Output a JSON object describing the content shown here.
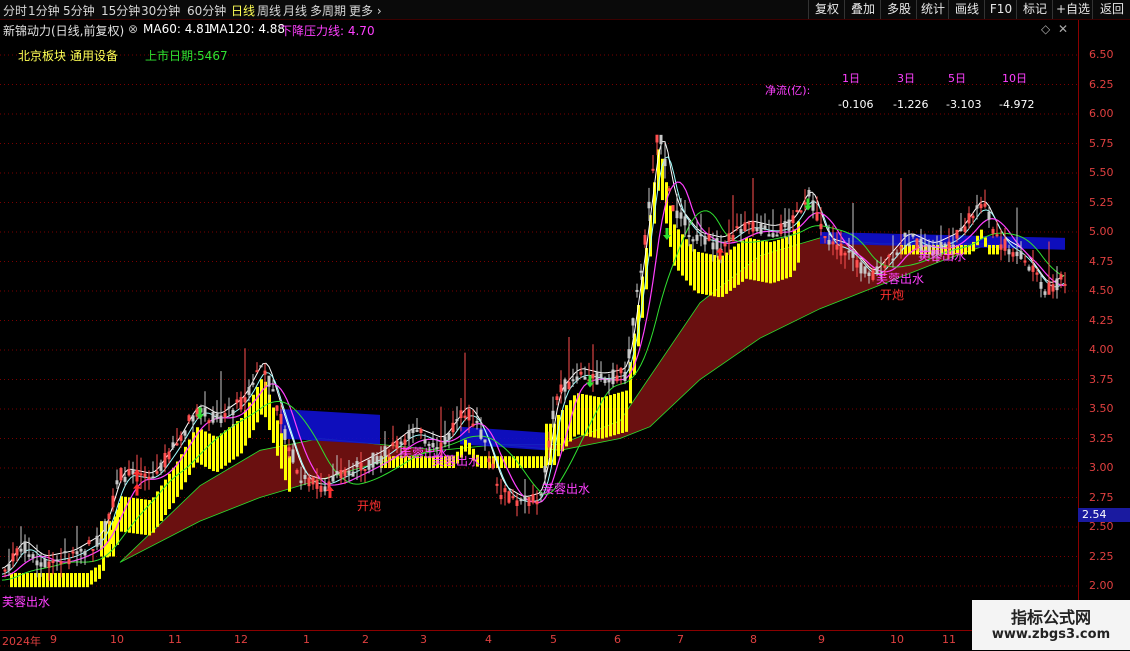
{
  "period_tabs": [
    "分时",
    "1分钟",
    "5分钟",
    "15分钟",
    "30分钟",
    "60分钟",
    "日线",
    "周线",
    "月线",
    "多周期",
    "更多"
  ],
  "active_period": "日线",
  "right_buttons": [
    "复权",
    "叠加",
    "多股",
    "统计",
    "画线",
    "F10",
    "标记",
    "+自选",
    "返回"
  ],
  "stock": {
    "title": "新锦动力(日线,前复权)",
    "ma60": "MA60: 4.81",
    "ma120": "MA120: 4.88",
    "resistance": "下降压力线: 4.70"
  },
  "sector": {
    "board": "北京板块",
    "industry": "通用设备",
    "listing_days": "上市日期:5467"
  },
  "flow": {
    "label": "净流(亿):",
    "headers": [
      "1日",
      "3日",
      "5日",
      "10日"
    ],
    "values": [
      "-0.106",
      "-1.226",
      "-3.103",
      "-4.972"
    ]
  },
  "annotations": {
    "furong": "芙蓉出水",
    "kaipao": "开炮"
  },
  "price_axis": [
    "6.50",
    "6.25",
    "6.00",
    "5.75",
    "5.50",
    "5.25",
    "5.00",
    "4.75",
    "4.50",
    "4.25",
    "4.00",
    "3.75",
    "3.50",
    "3.25",
    "3.00",
    "2.75",
    "2.50",
    "2.25",
    "2.00"
  ],
  "current_price": "2.54",
  "date_axis": [
    "2024年",
    "9",
    "10",
    "11",
    "12",
    "1",
    "2",
    "3",
    "4",
    "5",
    "6",
    "7",
    "8",
    "9",
    "10",
    "11"
  ],
  "watermark": {
    "line1": "指标公式网",
    "line2": "www.zbgs3.com"
  },
  "colors": {
    "up": "#ff3030",
    "down": "#40e0e0",
    "band_yellow": "#ffff00",
    "band_brown": "#6a1010",
    "ma_magenta": "#ff40ff",
    "ma_cyan": "#a0ffff",
    "accent_text": "#ffff55"
  }
}
